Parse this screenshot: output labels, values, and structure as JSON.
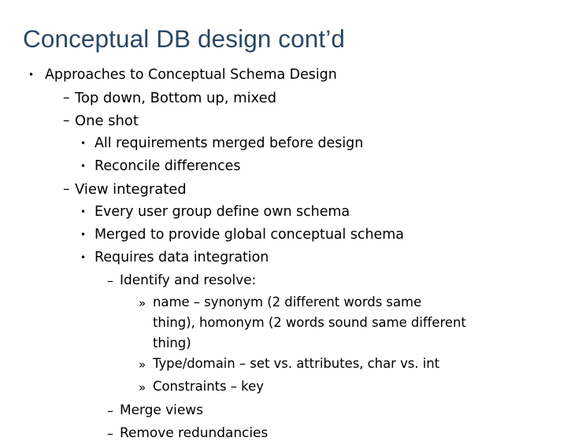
{
  "slide": {
    "title": "Conceptual DB design cont’d",
    "title_color": "#2b4764",
    "background_color": "#ffffff",
    "body_text_color": "#000000",
    "markers": {
      "level1": "•",
      "level2": "–",
      "level3": "•",
      "level4": "–",
      "level5": "»"
    },
    "bullets": [
      {
        "level": 1,
        "text": "Approaches to Conceptual Schema Design"
      },
      {
        "level": 2,
        "text": "Top down, Bottom up, mixed"
      },
      {
        "level": 2,
        "text": "One shot"
      },
      {
        "level": 3,
        "text": "All requirements merged before design"
      },
      {
        "level": 3,
        "text": "Reconcile differences"
      },
      {
        "level": 2,
        "text": "View integrated"
      },
      {
        "level": 3,
        "text": "Every user group define own schema"
      },
      {
        "level": 3,
        "text": "Merged to provide global conceptual schema"
      },
      {
        "level": 3,
        "text": "Requires data integration"
      },
      {
        "level": 4,
        "text": "Identify and resolve:"
      },
      {
        "level": 5,
        "text": "name – synonym (2 different words same thing), homonym (2 words sound same different thing)",
        "wraps": true
      },
      {
        "level": 5,
        "text": "Type/domain – set vs. attributes, char vs. int"
      },
      {
        "level": 5,
        "text": "Constraints – key"
      },
      {
        "level": 4,
        "text": "Merge views"
      },
      {
        "level": 4,
        "text": "Remove redundancies"
      }
    ]
  }
}
